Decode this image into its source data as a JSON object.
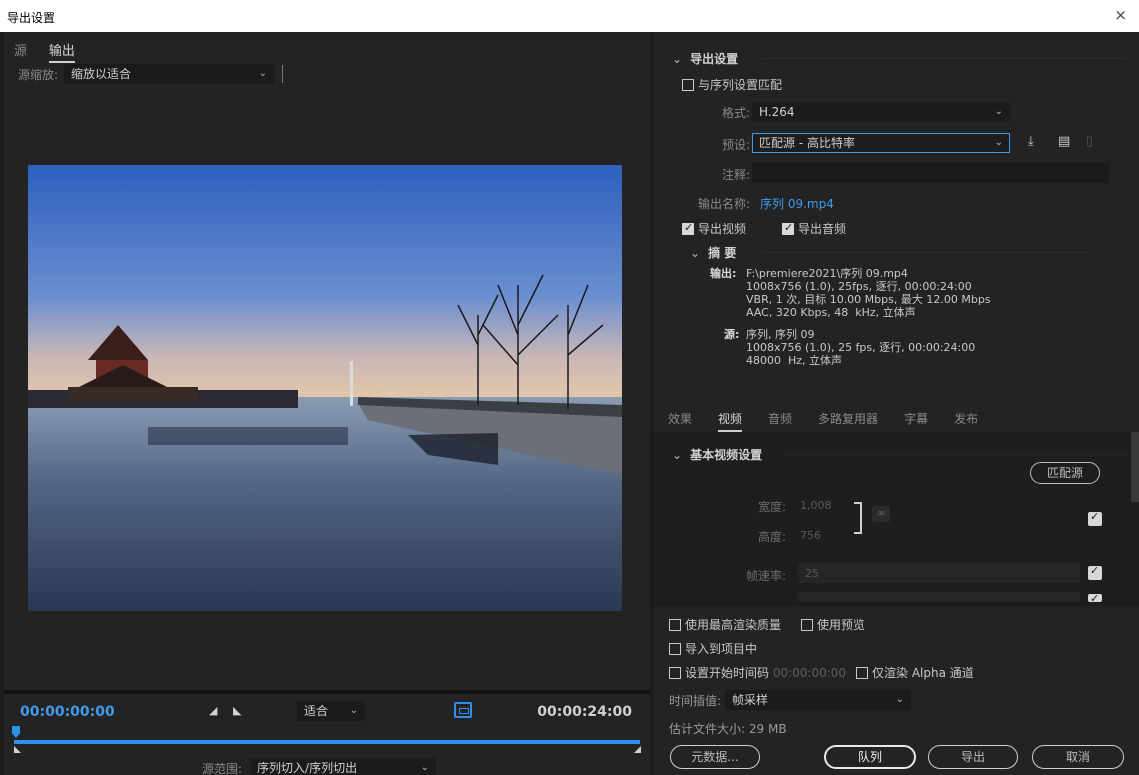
{
  "window": {
    "title": "导出设置",
    "close_glyph": "×"
  },
  "left": {
    "tabs": [
      "源",
      "输出"
    ],
    "active_tab_index": 1,
    "scale_label": "源缩放:",
    "scale_value": "缩放以适合",
    "timecode_start": "00:00:00:00",
    "timecode_end": "00:00:24:00",
    "fit_value": "适合",
    "range_label": "源范围:",
    "range_value": "序列切入/序列切出"
  },
  "export_settings": {
    "header": "导出设置",
    "match_sequence": {
      "label": "与序列设置匹配",
      "checked": false
    },
    "format_label": "格式:",
    "format_value": "H.264",
    "preset_label": "预设:",
    "preset_value": "匹配源 - 高比特率",
    "comment_label": "注释:",
    "comment_value": "",
    "output_name_label": "输出名称:",
    "output_name_value": "序列 09.mp4",
    "export_video": {
      "label": "导出视频",
      "checked": true
    },
    "export_audio": {
      "label": "导出音频",
      "checked": true
    }
  },
  "summary": {
    "header": "摘 要",
    "output_label": "输出:",
    "output_lines": [
      "F:\\premiere2021\\序列 09.mp4",
      "1008x756 (1.0), 25fps, 逐行, 00:00:24:00",
      "VBR, 1 次, 目标 10.00 Mbps, 最大 12.00 Mbps",
      "AAC, 320 Kbps, 48  kHz, 立体声"
    ],
    "source_label": "源:",
    "source_lines": [
      "序列, 序列 09",
      "1008x756 (1.0), 25 fps, 逐行, 00:00:24:00",
      "48000  Hz, 立体声"
    ]
  },
  "subtabs": [
    "效果",
    "视频",
    "音频",
    "多路复用器",
    "字幕",
    "发布"
  ],
  "active_subtab_index": 1,
  "video_basic": {
    "header": "基本视频设置",
    "match_source_button": "匹配源",
    "width_label": "宽度:",
    "width_value": "1,008",
    "height_label": "高度:",
    "height_value": "756",
    "framerate_label": "帧速率:",
    "framerate_value": "25"
  },
  "render_options": {
    "max_render_quality": "使用最高渲染质量",
    "use_previews": "使用预览",
    "import_into_project": "导入到项目中",
    "set_start_timecode": "设置开始时间码",
    "start_timecode_value": "00:00:00:00",
    "render_alpha_only": "仅渲染 Alpha 通道",
    "time_interp_label": "时间插值:",
    "time_interp_value": "帧采样",
    "estimated_size_label": "估计文件大小:",
    "estimated_size_value": "29 MB"
  },
  "buttons": {
    "metadata": "元数据...",
    "queue": "队列",
    "export": "导出",
    "cancel": "取消"
  },
  "colors": {
    "accent_blue": "#2e8ff0",
    "timecode_blue": "#3f9bf0",
    "panel_bg": "#232323"
  },
  "icons": {
    "save_preset": "download-icon",
    "import_preset": "import-preset-icon",
    "delete_preset": "trash-icon",
    "link": "chain-link-icon"
  }
}
